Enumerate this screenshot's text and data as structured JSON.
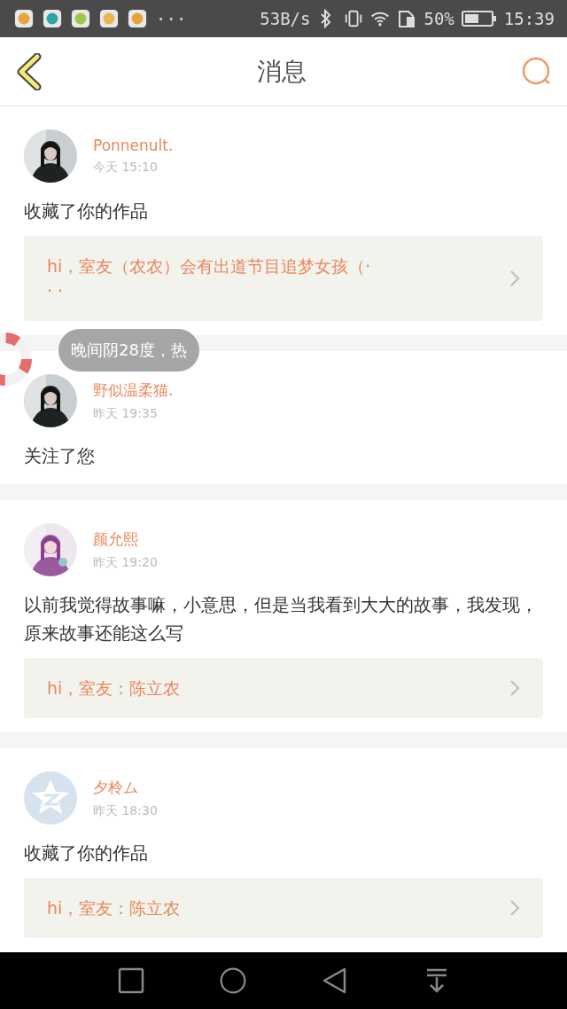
{
  "status_bar": {
    "more": "···",
    "net_speed": "53B/s",
    "battery": "50%",
    "time": "15:39"
  },
  "header": {
    "title": "消息"
  },
  "messages": [
    {
      "name": "Ponnenult.",
      "time": "今天 15:10",
      "action": "收藏了你的作品",
      "quote": "hi，室友（农农）会有出道节目追梦女孩（· · ·"
    },
    {
      "name": "野似温柔猫.",
      "time": "昨天 19:35",
      "action": "关注了您"
    },
    {
      "name": "颜允熙",
      "time": "昨天 19:20",
      "action": "以前我觉得故事嘛，小意思，但是当我看到大大的故事，我发现，原来故事还能这么写",
      "quote": "hi，室友：陈立农"
    },
    {
      "avatar": {
        "kind": "default"
      },
      "name": "夕柃ム",
      "time": "昨天 18:30",
      "action": "收藏了你的作品",
      "quote": "hi，室友：陈立农"
    }
  ],
  "toast": {
    "text": "晚间阴28度，热"
  }
}
